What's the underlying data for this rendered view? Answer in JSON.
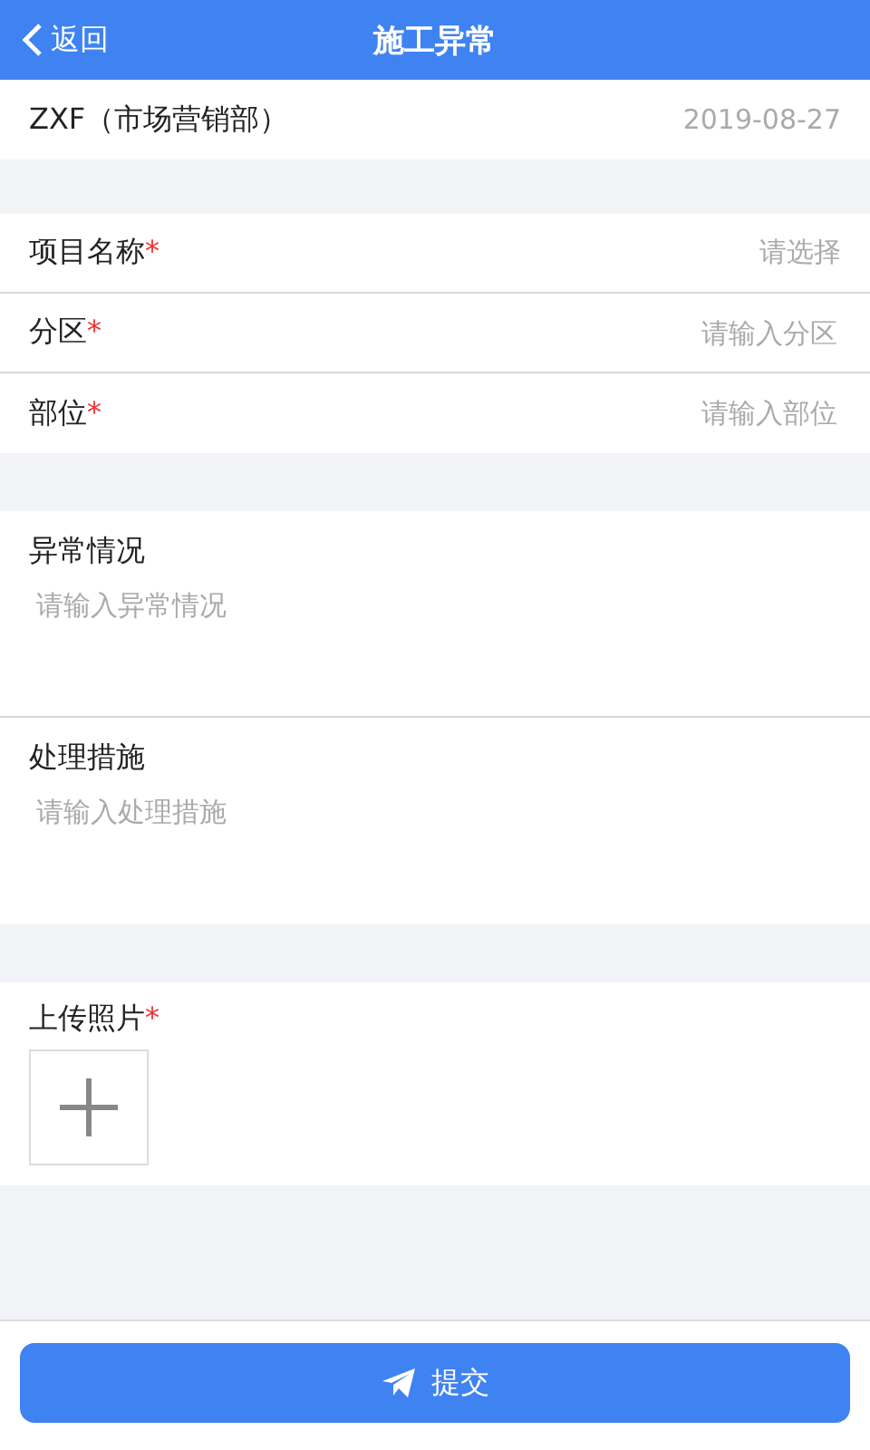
{
  "header": {
    "back_label": "返回",
    "title": "施工异常"
  },
  "info": {
    "user": "ZXF（市场营销部）",
    "date": "2019-08-27"
  },
  "fields": [
    {
      "label": "项目名称",
      "required_mark": "*",
      "placeholder": "请选择",
      "kind": "select"
    },
    {
      "label": "分区",
      "required_mark": "*",
      "placeholder": "请输入分区",
      "kind": "input"
    },
    {
      "label": "部位",
      "required_mark": "*",
      "placeholder": "请输入部位",
      "kind": "input"
    }
  ],
  "text_areas": [
    {
      "label": "异常情况",
      "placeholder": "请输入异常情况"
    },
    {
      "label": "处理措施",
      "placeholder": "请输入处理措施"
    }
  ],
  "upload": {
    "label": "上传照片",
    "required_mark": "*"
  },
  "submit": {
    "label": "提交"
  }
}
